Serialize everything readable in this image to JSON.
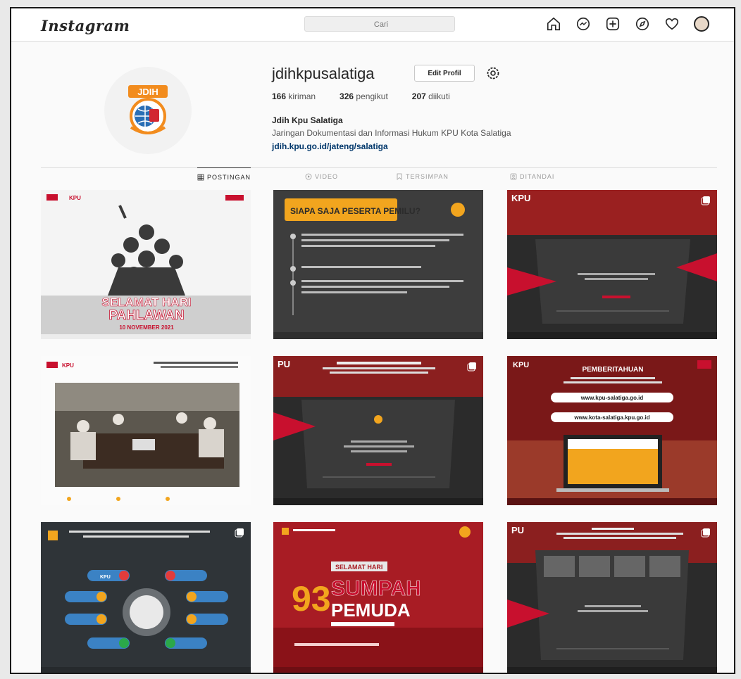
{
  "app": {
    "logo": "Instagram"
  },
  "search": {
    "placeholder": "Cari"
  },
  "nav": {
    "icons": [
      "home-icon",
      "messenger-icon",
      "new-post-icon",
      "explore-icon",
      "activity-heart-icon",
      "profile-avatar"
    ]
  },
  "profile": {
    "username": "jdihkpusalatiga",
    "edit_label": "Edit Profil",
    "posts_count": "166",
    "posts_label": "kiriman",
    "followers_count": "326",
    "followers_label": "pengikut",
    "following_count": "207",
    "following_label": "diikuti",
    "full_name": "Jdih Kpu Salatiga",
    "bio": "Jaringan Dokumentasi dan Informasi Hukum KPU Kota Salatiga",
    "link": "jdih.kpu.go.id/jateng/salatiga",
    "avatar_text": "JDIH"
  },
  "tabs": [
    {
      "label": "POSTINGAN",
      "icon": "grid-icon"
    },
    {
      "label": "VIDEO",
      "icon": "video-icon"
    },
    {
      "label": "TERSIMPAN",
      "icon": "bookmark-icon"
    },
    {
      "label": "DITANDAI",
      "icon": "tag-icon"
    }
  ],
  "posts": [
    {
      "headline": "SELAMAT HARI",
      "title": "PAHLAWAN",
      "subtitle": "10 NOVEMBER 2021",
      "logo": "KPU"
    },
    {
      "headline": "SIAPA SAJA PESERTA PEMILU?",
      "title": "",
      "subtitle": ""
    },
    {
      "headline": "KPU",
      "title": "",
      "subtitle": ""
    },
    {
      "headline": "KPU",
      "title": "",
      "subtitle": ""
    },
    {
      "headline": "PU",
      "title": "",
      "subtitle": ""
    },
    {
      "headline": "PEMBERITAHUAN",
      "title": "www.kpu-salatiga.go.id",
      "subtitle": "www.kota-salatiga.kpu.go.id",
      "logo": "KPU"
    },
    {
      "headline": "",
      "title": "KPU",
      "subtitle": ""
    },
    {
      "headline": "SELAMAT HARI",
      "title": "SUMPAH",
      "subtitle": "PEMUDA",
      "number": "93"
    },
    {
      "headline": "PU",
      "title": "",
      "subtitle": ""
    }
  ],
  "colors": {
    "accent": "#c8102e",
    "dark": "#2b2b2b",
    "link": "#00376b"
  }
}
